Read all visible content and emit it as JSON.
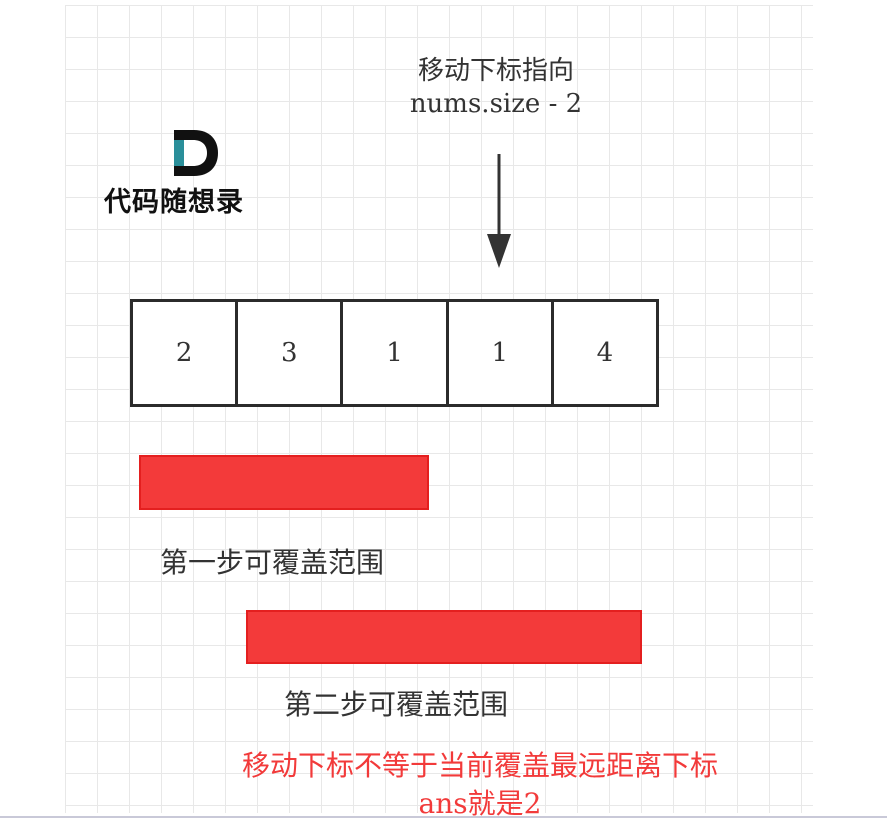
{
  "pointer": {
    "title": "移动下标指向",
    "expr": "nums.size - 2"
  },
  "logo": {
    "mark": "D",
    "text": "代码随想录"
  },
  "array": {
    "values": [
      "2",
      "3",
      "1",
      "1",
      "4"
    ]
  },
  "ranges": [
    {
      "label": "第一步可覆盖范围"
    },
    {
      "label": "第二步可覆盖范围"
    }
  ],
  "conclusion": {
    "line1": "移动下标不等于当前覆盖最远距离下标",
    "line2": "ans就是2"
  },
  "colors": {
    "accent": "#f33a3a",
    "text": "#333333",
    "border": "#2b2b2b",
    "logo_teal": "#2a8f9a"
  }
}
